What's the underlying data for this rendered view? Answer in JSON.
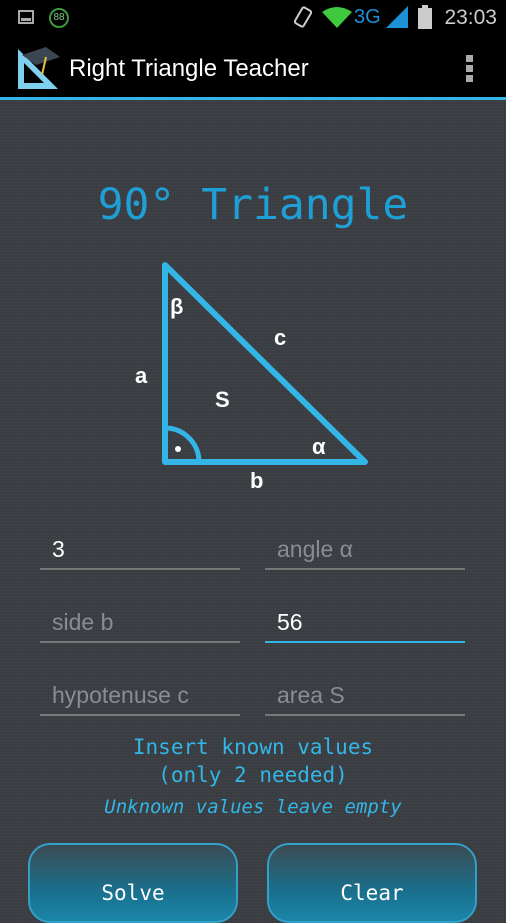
{
  "status_bar": {
    "time": "23:03",
    "network": "3G",
    "battery_badge": "88",
    "icons": [
      "image-icon",
      "battery-saver-icon",
      "vibrate-icon",
      "wifi-icon",
      "signal-icon",
      "battery-icon"
    ]
  },
  "app_bar": {
    "title": "Right Triangle Teacher",
    "icons": [
      "app-logo-icon",
      "overflow-menu-icon"
    ]
  },
  "heading": "90° Triangle",
  "diagram": {
    "labels": {
      "beta": "β",
      "c": "c",
      "a": "a",
      "S": "S",
      "alpha": "α",
      "b": "b"
    }
  },
  "fields": [
    {
      "name": "side-a",
      "value": "3",
      "placeholder": ""
    },
    {
      "name": "angle-alpha",
      "value": "",
      "placeholder": "angle α"
    },
    {
      "name": "side-b",
      "value": "",
      "placeholder": "side b"
    },
    {
      "name": "angle-beta",
      "value": "56",
      "placeholder": "",
      "focused": true
    },
    {
      "name": "hypotenuse-c",
      "value": "",
      "placeholder": "hypotenuse c"
    },
    {
      "name": "area-s",
      "value": "",
      "placeholder": "area S"
    }
  ],
  "info": {
    "line1": "Insert known values",
    "line2": "(only 2 needed)",
    "line3": "Unknown values leave empty"
  },
  "buttons": {
    "solve": "Solve",
    "clear": "Clear"
  },
  "colors": {
    "accent": "#33b5e5",
    "heading": "#1e9fd6"
  }
}
